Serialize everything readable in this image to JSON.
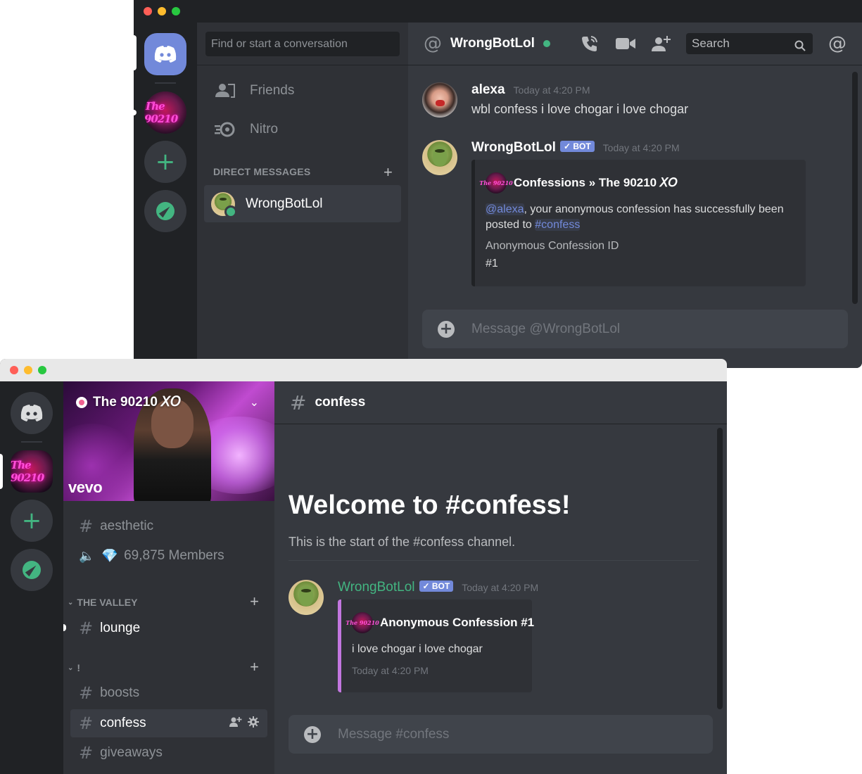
{
  "dm_window": {
    "dm_search_placeholder": "Find or start a conversation",
    "nav": {
      "friends": "Friends",
      "nitro": "Nitro"
    },
    "direct_messages_header": "DIRECT MESSAGES",
    "dm_list": [
      {
        "name": "WrongBotLol",
        "status": "online"
      }
    ],
    "header": {
      "title": "WrongBotLol",
      "search_placeholder": "Search"
    },
    "messages": [
      {
        "author": "alexa",
        "timestamp": "Today at 4:20 PM",
        "text": "wbl confess i love chogar i love chogar"
      },
      {
        "author": "WrongBotLol",
        "badge": "✓ BOT",
        "timestamp": "Today at 4:20 PM",
        "embed": {
          "author": "Confessions » The 90210 𝘟𝘖",
          "mention": "@alexa",
          "desc_mid": ", your anonymous confession has successfully been posted to ",
          "channel_mention": "#confess",
          "field_name": "Anonymous Confession ID",
          "field_value": "#1"
        }
      }
    ],
    "composer_placeholder": "Message @WrongBotLol"
  },
  "server_window": {
    "server_name": "The 90210 𝘟𝘖",
    "banner_brand": "vevo",
    "guild_icon_text": "The 90210",
    "channels_top": [
      {
        "name": "aesthetic"
      },
      {
        "name": "69,875 Members",
        "emoji": "💎"
      }
    ],
    "categories": [
      {
        "name": "THE VALLEY",
        "channels": [
          "lounge"
        ]
      },
      {
        "name": "!",
        "channels": [
          "boosts",
          "confess",
          "giveaways"
        ]
      }
    ],
    "channel_header": "confess",
    "welcome_title": "Welcome to #confess!",
    "welcome_sub": "This is the start of the #confess channel.",
    "message": {
      "author": "WrongBotLol",
      "badge": "✓ BOT",
      "timestamp": "Today at 4:20 PM",
      "embed": {
        "title": "Anonymous Confession #1",
        "text": "i love chogar i love chogar",
        "footer": "Today at 4:20 PM"
      }
    },
    "composer_placeholder": "Message #confess"
  },
  "colors": {
    "blurple": "#7289da",
    "green": "#43b581",
    "bg": "#36393f",
    "sidebar": "#2f3136",
    "rail": "#202225",
    "embed_accent": "#c377e0"
  }
}
